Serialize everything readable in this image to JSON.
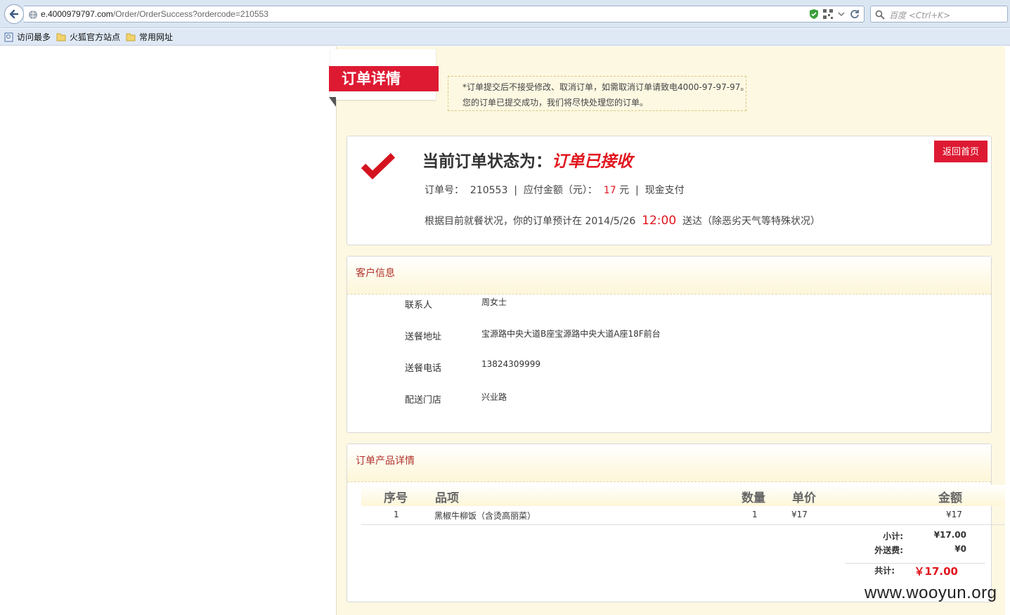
{
  "browser": {
    "url_host": "e.4000979797.com",
    "url_path": "/Order/OrderSuccess?ordercode=210553",
    "search_placeholder": "百度 <Ctrl+K>",
    "bookmarks": [
      "访问最多",
      "火狐官方站点",
      "常用网址"
    ]
  },
  "ribbon_title": "订单详情",
  "notice": {
    "line1": "*订单提交后不接受修改、取消订单，如需取消订单请致电4000-97-97-97。",
    "line2": "您的订单已提交成功，我们将尽快处理您的订单。"
  },
  "status": {
    "label": "当前订单状态为：",
    "value": "订单已接收",
    "order_no_label": "订单号：",
    "order_no": "210553",
    "sep": "|",
    "amount_label": "应付金额（元）：",
    "amount": "17",
    "currency": "元",
    "payment": "现金支付",
    "delivery_prefix": "根据目前就餐状况，你的订单预计在 2014/5/26",
    "delivery_time": "12:00",
    "delivery_suffix": "送达（除恶劣天气等特殊状况）",
    "home_button": "返回首页"
  },
  "customer": {
    "title": "客户信息",
    "rows": [
      {
        "label": "联系人",
        "value": "周女士"
      },
      {
        "label": "送餐地址",
        "value": "宝源路中央大道B座宝源路中央大道A座18F前台"
      },
      {
        "label": "送餐电话",
        "value": "13824309999"
      },
      {
        "label": "配送门店",
        "value": "兴业路"
      }
    ]
  },
  "products": {
    "title": "订单产品详情",
    "columns": [
      "序号",
      "品项",
      "数量",
      "单价",
      "金额"
    ],
    "items": [
      {
        "no": "1",
        "name": "黑椒牛柳饭（含烫高丽菜）",
        "qty": "1",
        "price": "¥17",
        "amount": "¥17"
      }
    ],
    "subtotal_label": "小计:",
    "subtotal": "¥17.00",
    "delivery_fee_label": "外送费:",
    "delivery_fee": "¥0",
    "total_label": "共计:",
    "total": "￥17.00"
  },
  "watermark": "www.wooyun.org",
  "colors": {
    "accent_red": "#de1a33",
    "page_bg": "#fdf8e2",
    "header_text": "#b0322b"
  }
}
